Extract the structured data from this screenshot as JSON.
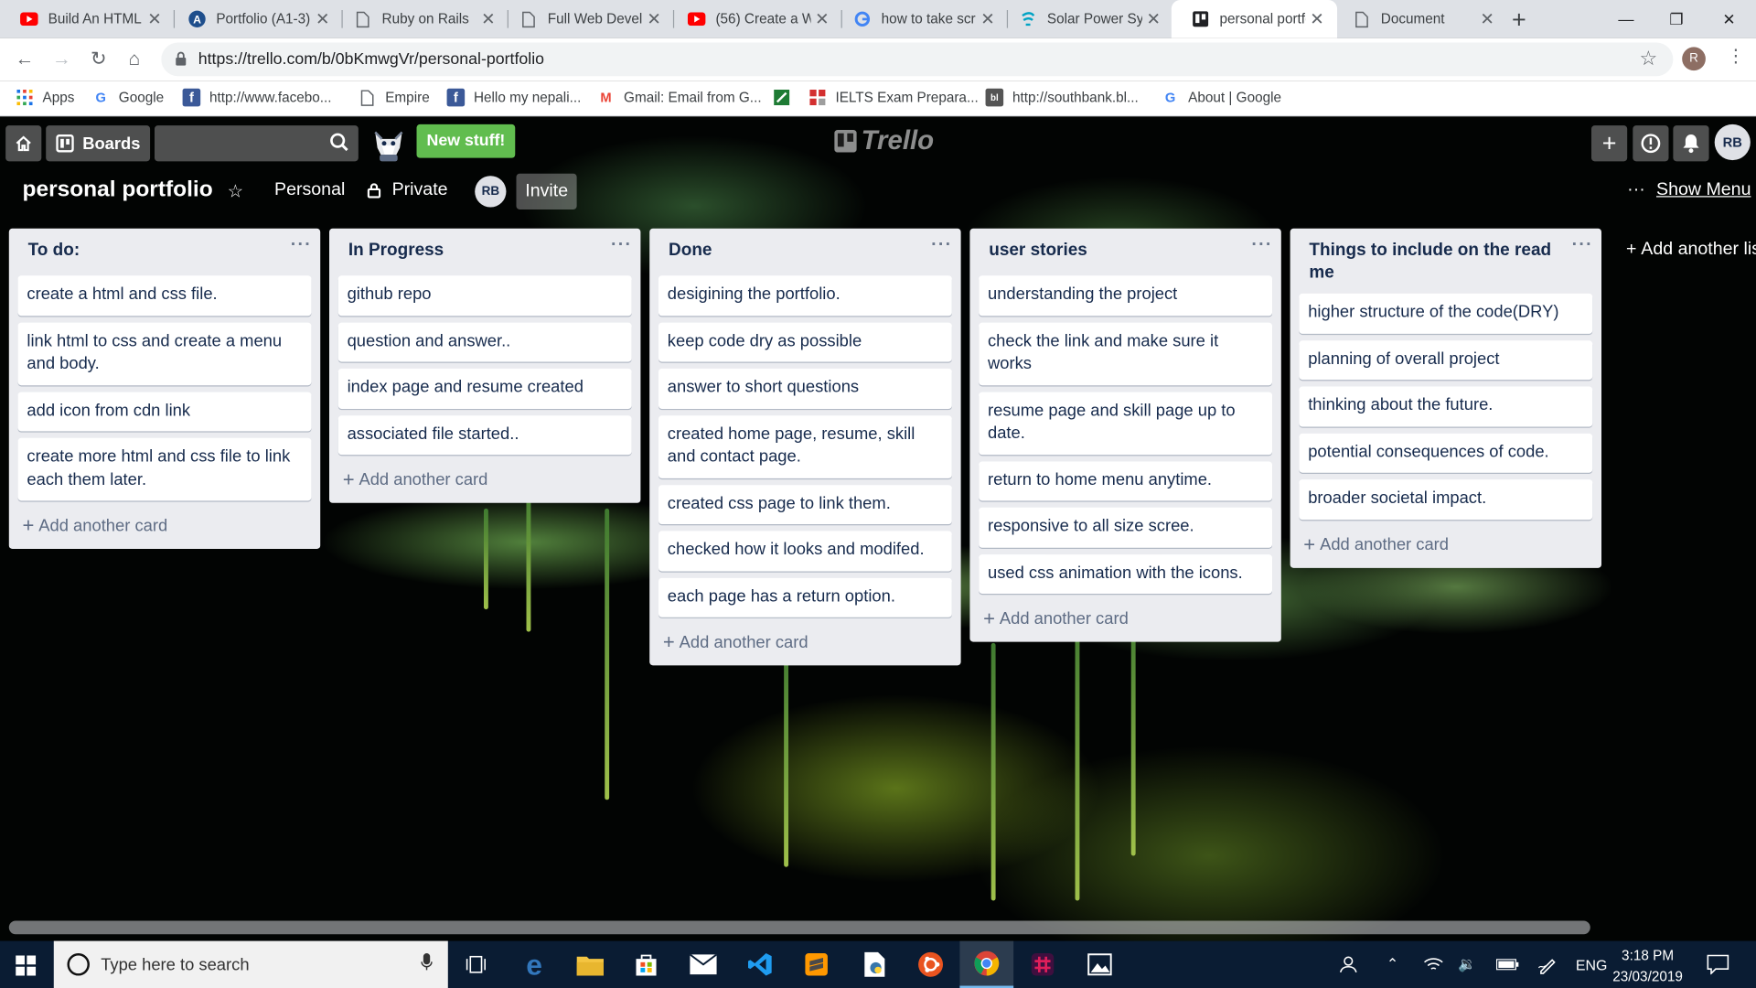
{
  "browser": {
    "tabs": [
      {
        "label": "Build An HTML",
        "icon": "youtube-icon",
        "active": false
      },
      {
        "label": "Portfolio (A1-3)",
        "icon": "portfolio-site-icon",
        "active": false
      },
      {
        "label": "Ruby on Rails",
        "icon": "document-icon",
        "active": false
      },
      {
        "label": "Full Web Devel",
        "icon": "document-icon",
        "active": false
      },
      {
        "label": "(56) Create a W",
        "icon": "youtube-icon",
        "active": false
      },
      {
        "label": "how to take scr",
        "icon": "google-icon",
        "active": false
      },
      {
        "label": "Solar Power Sys",
        "icon": "solar-site-icon",
        "active": false
      },
      {
        "label": "personal portfo",
        "icon": "trello-icon",
        "active": true
      },
      {
        "label": "Document",
        "icon": "document-icon",
        "active": false
      }
    ],
    "url": "https://trello.com/b/0bKmwgVr/personal-portfolio",
    "profile_initial": "R",
    "bookmarks": [
      {
        "label": "Apps",
        "icon": "apps-grid-icon"
      },
      {
        "label": "Google",
        "icon": "google-icon"
      },
      {
        "label": "http://www.facebo...",
        "icon": "facebook-icon"
      },
      {
        "label": "Empire",
        "icon": "document-icon"
      },
      {
        "label": "Hello my nepali...",
        "icon": "facebook-icon"
      },
      {
        "label": "Gmail: Email from G...",
        "icon": "gmail-icon"
      },
      {
        "label": "",
        "icon": "green-app-icon"
      },
      {
        "label": "IELTS Exam Prepara...",
        "icon": "ielts-icon"
      },
      {
        "label": "http://southbank.bl...",
        "icon": "blog-icon"
      },
      {
        "label": "About | Google",
        "icon": "google-icon"
      }
    ]
  },
  "trello": {
    "header": {
      "boards_label": "Boards",
      "new_stuff_label": "New stuff!",
      "logo_text": "Trello",
      "user_initials": "RB"
    },
    "board": {
      "title": "personal portfolio",
      "team_label": "Personal",
      "visibility_label": "Private",
      "member_initials": "RB",
      "invite_label": "Invite",
      "show_menu_label": "Show Menu",
      "add_list_label": "Add another list"
    },
    "add_card_label": "Add another card",
    "lists": [
      {
        "title": "To do:",
        "cards": [
          "create a html and css file.",
          "link html to css and create a menu and body.",
          "add icon from cdn link",
          "create more html and css file to link each them later."
        ]
      },
      {
        "title": "In Progress",
        "cards": [
          "github repo",
          "question and answer..",
          "index page and resume created",
          "associated file started.."
        ]
      },
      {
        "title": "Done",
        "cards": [
          "desigining the portfolio.",
          "keep code dry as possible",
          "answer to short questions",
          "created home page, resume, skill and contact page.",
          "created css page to link them.",
          "checked how it looks and modifed.",
          "each page has a return option."
        ]
      },
      {
        "title": "user stories",
        "cards": [
          "understanding the project",
          "check the link and make sure it works",
          "resume page and skill page up to date.",
          "return to home menu anytime.",
          "responsive to all size scree.",
          "used css animation with the icons."
        ]
      },
      {
        "title": "Things to include on the read me",
        "cards": [
          "higher structure of the code(DRY)",
          "planning of overall project",
          "thinking about the future.",
          "potential consequences of code.",
          "broader societal impact."
        ]
      }
    ]
  },
  "taskbar": {
    "search_placeholder": "Type here to search",
    "language": "ENG",
    "time": "3:18 PM",
    "date": "23/03/2019"
  },
  "colors": {
    "new_stuff_green": "#61bd4f",
    "list_bg": "#ebecf0",
    "card_text": "#172b4d"
  }
}
